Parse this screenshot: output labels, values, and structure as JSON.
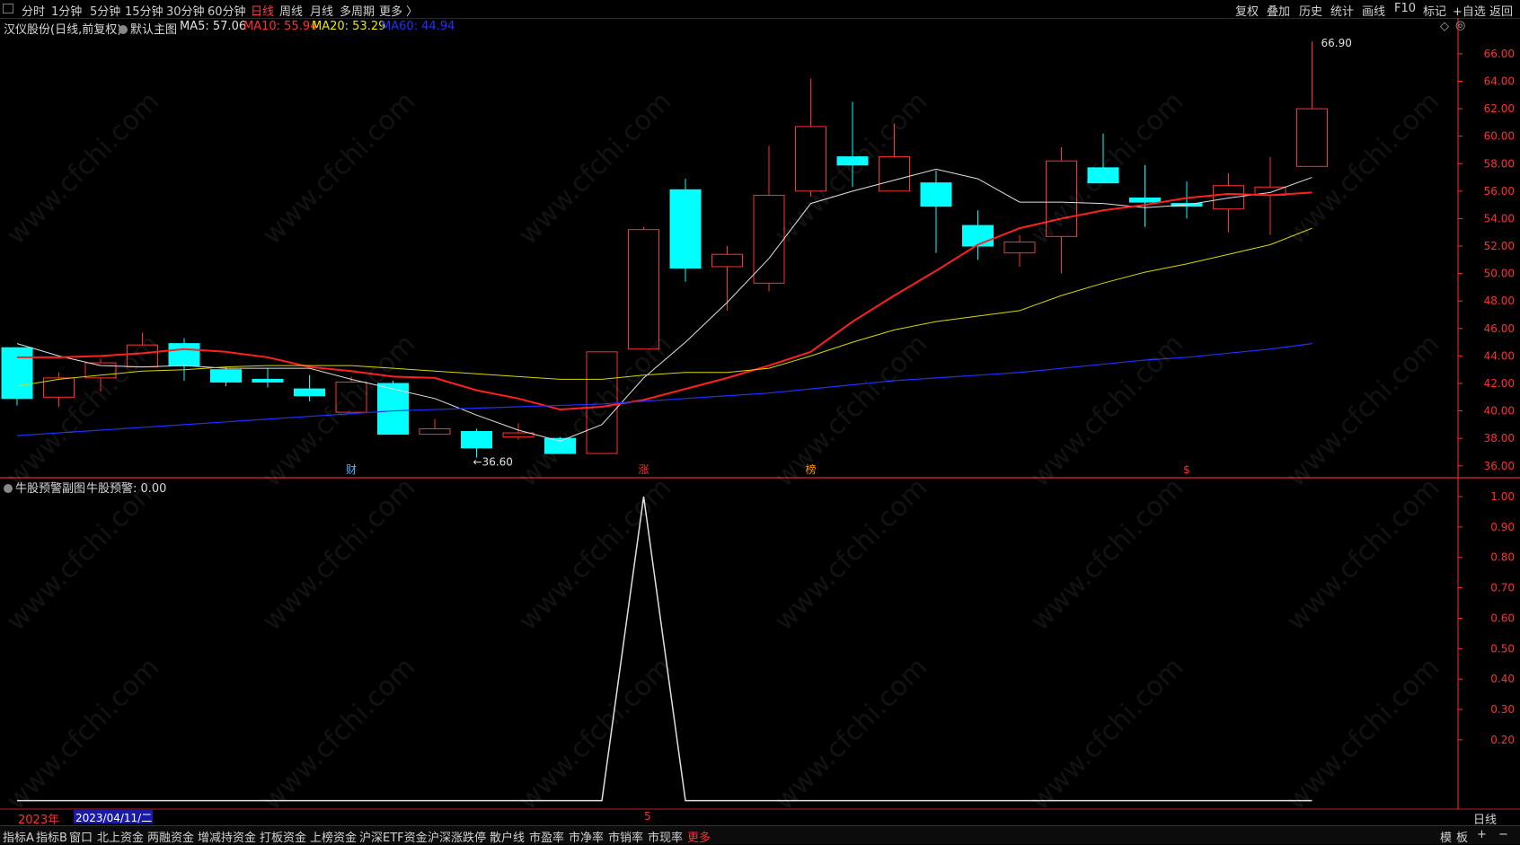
{
  "toolbar": {
    "periods": [
      {
        "label": "分时",
        "active": false
      },
      {
        "label": "1分钟",
        "active": false
      },
      {
        "label": "5分钟",
        "active": false
      },
      {
        "label": "15分钟",
        "active": false
      },
      {
        "label": "30分钟",
        "active": false
      },
      {
        "label": "60分钟",
        "active": false
      },
      {
        "label": "日线",
        "active": true
      },
      {
        "label": "周线",
        "active": false
      },
      {
        "label": "月线",
        "active": false
      },
      {
        "label": "多周期",
        "active": false
      },
      {
        "label": "更多 〉",
        "active": false
      }
    ],
    "right": [
      "复权",
      "叠加",
      "历史",
      "统计",
      "画线",
      "F10",
      "标记",
      "+自选",
      "返回"
    ]
  },
  "main_header": {
    "stock": "汉仪股份(日线,前复权)",
    "indicator": "默认主图",
    "ma5": "MA5: 57.06",
    "ma10": "MA10: 55.94",
    "ma20": "MA20: 53.29",
    "ma60": "MA60: 44.94"
  },
  "sub_header": {
    "name": "牛股预警副图",
    "value": "牛股预警: 0.00"
  },
  "colors": {
    "up": "#ff3030",
    "down": "#00ffff",
    "ma5": "#e0e0e0",
    "ma10": "#ff2020",
    "ma20": "#d8d800",
    "ma60": "#2030ff",
    "axis": "#ff3030"
  },
  "chart_data": [
    {
      "type": "candlestick",
      "y_ticks": [
        "66.00",
        "64.00",
        "62.00",
        "60.00",
        "58.00",
        "56.00",
        "54.00",
        "52.00",
        "50.00",
        "48.00",
        "46.00",
        "44.00",
        "42.00",
        "40.00",
        "38.00",
        "36.00"
      ],
      "ylim": [
        35.2,
        67.3
      ],
      "candles": [
        {
          "o": 44.6,
          "c": 40.9,
          "h": 44.6,
          "l": 40.4
        },
        {
          "o": 41.0,
          "c": 42.4,
          "h": 42.8,
          "l": 40.3
        },
        {
          "o": 42.4,
          "c": 43.5,
          "h": 43.8,
          "l": 41.4
        },
        {
          "o": 43.2,
          "c": 44.8,
          "h": 45.7,
          "l": 43.2
        },
        {
          "o": 44.9,
          "c": 43.3,
          "h": 45.3,
          "l": 42.2
        },
        {
          "o": 43.0,
          "c": 42.1,
          "h": 43.2,
          "l": 41.8
        },
        {
          "o": 42.3,
          "c": 42.1,
          "h": 43.1,
          "l": 41.7
        },
        {
          "o": 41.6,
          "c": 41.1,
          "h": 42.6,
          "l": 40.7
        },
        {
          "o": 39.9,
          "c": 42.1,
          "h": 42.5,
          "l": 39.9
        },
        {
          "o": 42.0,
          "c": 38.3,
          "h": 42.2,
          "l": 38.3
        },
        {
          "o": 38.3,
          "c": 38.7,
          "h": 39.4,
          "l": 38.3
        },
        {
          "o": 38.5,
          "c": 37.3,
          "h": 38.7,
          "l": 36.6
        },
        {
          "o": 38.1,
          "c": 38.4,
          "h": 39.1,
          "l": 37.9
        },
        {
          "o": 38.0,
          "c": 36.9,
          "h": 38.1,
          "l": 36.9
        },
        {
          "o": 36.9,
          "c": 44.3,
          "h": 44.3,
          "l": 36.9
        },
        {
          "o": 44.5,
          "c": 53.2,
          "h": 53.4,
          "l": 44.5
        },
        {
          "o": 56.1,
          "c": 50.4,
          "h": 56.9,
          "l": 49.4
        },
        {
          "o": 50.5,
          "c": 51.4,
          "h": 52.0,
          "l": 47.3
        },
        {
          "o": 49.3,
          "c": 55.7,
          "h": 59.3,
          "l": 48.7
        },
        {
          "o": 56.0,
          "c": 60.7,
          "h": 64.2,
          "l": 55.6
        },
        {
          "o": 58.5,
          "c": 57.9,
          "h": 62.5,
          "l": 56.3
        },
        {
          "o": 56.0,
          "c": 58.5,
          "h": 60.9,
          "l": 56.0
        },
        {
          "o": 56.6,
          "c": 54.9,
          "h": 57.5,
          "l": 51.5
        },
        {
          "o": 53.5,
          "c": 52.0,
          "h": 54.6,
          "l": 51.0
        },
        {
          "o": 51.5,
          "c": 52.3,
          "h": 52.8,
          "l": 50.5
        },
        {
          "o": 52.7,
          "c": 58.2,
          "h": 59.2,
          "l": 50.0
        },
        {
          "o": 57.7,
          "c": 56.6,
          "h": 60.2,
          "l": 56.6
        },
        {
          "o": 55.5,
          "c": 55.2,
          "h": 57.9,
          "l": 53.4
        },
        {
          "o": 55.1,
          "c": 54.9,
          "h": 56.7,
          "l": 54.0
        },
        {
          "o": 54.7,
          "c": 56.4,
          "h": 57.3,
          "l": 53.0
        },
        {
          "o": 55.7,
          "c": 56.3,
          "h": 58.5,
          "l": 52.8
        },
        {
          "o": 57.8,
          "c": 62.0,
          "h": 66.9,
          "l": 57.8
        }
      ],
      "series": [
        {
          "name": "MA5",
          "values": [
            44.9,
            44.0,
            43.3,
            43.2,
            43.3,
            43.1,
            43.1,
            43.1,
            42.3,
            41.6,
            40.9,
            39.7,
            38.6,
            37.8,
            39.0,
            42.4,
            45.0,
            47.9,
            51.1,
            55.1,
            56.0,
            56.8,
            57.6,
            56.9,
            55.2,
            55.2,
            55.1,
            54.8,
            55.0,
            55.5,
            55.9,
            57.0
          ]
        },
        {
          "name": "MA10",
          "values": [
            43.9,
            43.9,
            44.0,
            44.2,
            44.5,
            44.3,
            43.9,
            43.2,
            42.9,
            42.5,
            42.4,
            41.5,
            40.9,
            40.1,
            40.3,
            40.8,
            41.6,
            42.4,
            43.3,
            44.3,
            46.5,
            48.4,
            50.2,
            52.1,
            53.3,
            54.0,
            54.6,
            55.0,
            55.5,
            55.8,
            55.7,
            55.9
          ]
        },
        {
          "name": "MA20",
          "values": [
            41.8,
            42.3,
            42.6,
            42.9,
            43.0,
            43.2,
            43.3,
            43.3,
            43.3,
            43.1,
            42.9,
            42.7,
            42.5,
            42.3,
            42.3,
            42.6,
            42.8,
            42.8,
            43.1,
            44.0,
            45.0,
            45.9,
            46.5,
            46.9,
            47.3,
            48.4,
            49.3,
            50.1,
            50.7,
            51.4,
            52.1,
            53.3
          ]
        },
        {
          "name": "MA60",
          "values": [
            38.2,
            38.4,
            38.6,
            38.8,
            39.0,
            39.2,
            39.4,
            39.6,
            39.8,
            40.0,
            40.1,
            40.2,
            40.3,
            40.4,
            40.5,
            40.7,
            40.9,
            41.1,
            41.3,
            41.6,
            41.9,
            42.2,
            42.4,
            42.6,
            42.8,
            43.1,
            43.4,
            43.7,
            43.9,
            44.2,
            44.5,
            44.9
          ]
        }
      ],
      "annotations": [
        {
          "text": "←36.60",
          "index": 11
        },
        {
          "text": "66.90",
          "index": 31
        }
      ],
      "markers": [
        {
          "text": "财",
          "index": 8,
          "color": "#4db8ff"
        },
        {
          "text": "涨",
          "index": 15,
          "color": "#ff3030"
        },
        {
          "text": "榜",
          "index": 19,
          "color": "#ff9900"
        },
        {
          "text": "$",
          "index": 28,
          "color": "#ff3030"
        }
      ]
    },
    {
      "type": "line",
      "name": "牛股预警",
      "y_ticks": [
        "1.00",
        "0.90",
        "0.80",
        "0.70",
        "0.60",
        "0.50",
        "0.40",
        "0.30",
        "0.20"
      ],
      "ylim": [
        -0.01,
        1.0
      ],
      "x_start": 0,
      "values": [
        0,
        0,
        0,
        0,
        0,
        0,
        0,
        0,
        0,
        0,
        0,
        0,
        0,
        0,
        0,
        1,
        0,
        0,
        0,
        0,
        0,
        0,
        0,
        0,
        0,
        0,
        0,
        0,
        0,
        0,
        0,
        0
      ]
    }
  ],
  "date_bar": {
    "year": "2023年",
    "date": "2023/04/11/二",
    "mark": "5",
    "period": "日线"
  },
  "statusbar": {
    "tabs": [
      "指标A",
      "指标B",
      "窗口",
      "北上资金",
      "两融资金",
      "增减持资金",
      "打板资金",
      "上榜资金",
      "沪深ETF资金",
      "沪深涨跌停",
      "散户线",
      "市盈率",
      "市净率",
      "市销率",
      "市现率",
      "更多"
    ],
    "right": [
      "模",
      "板",
      "+",
      "−"
    ]
  },
  "watermark": "www.cfchi.com"
}
